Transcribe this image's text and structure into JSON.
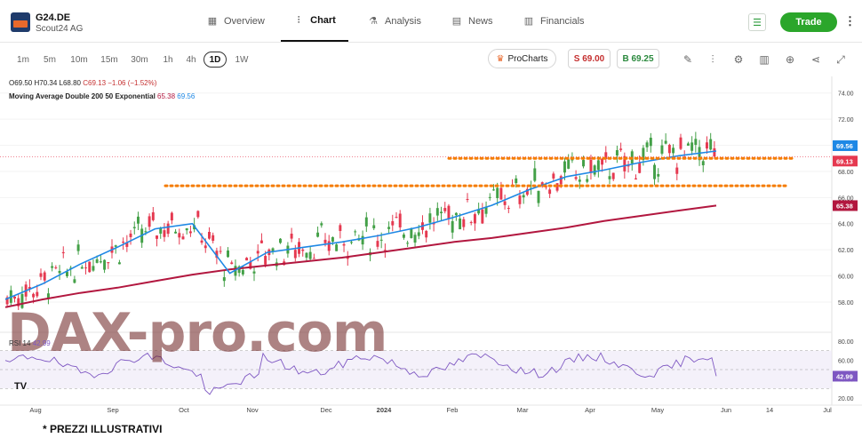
{
  "header": {
    "ticker": "G24.DE",
    "company": "Scout24 AG",
    "tabs": [
      {
        "label": "Overview",
        "icon": "grid-icon"
      },
      {
        "label": "Chart",
        "icon": "candlestick-icon"
      },
      {
        "label": "Analysis",
        "icon": "flask-icon"
      },
      {
        "label": "News",
        "icon": "news-icon"
      },
      {
        "label": "Financials",
        "icon": "bar-chart-icon"
      }
    ],
    "trade_label": "Trade"
  },
  "toolbar": {
    "timeframes": [
      "1m",
      "5m",
      "10m",
      "15m",
      "30m",
      "1h",
      "4h",
      "1D",
      "1W"
    ],
    "active_timeframe": "1D",
    "prochart_label": "ProCharts",
    "sell_label": "S 69.00",
    "buy_label": "B 69.25",
    "tools": [
      "pen-icon",
      "indicators-icon",
      "settings-icon",
      "compare-icon",
      "add-icon",
      "share-icon",
      "fullscreen-icon"
    ]
  },
  "legend": {
    "open": "O69.50",
    "high": "H70.34",
    "low": "L68.80",
    "close": "C69.13",
    "change": "−1.06 (−1.52%)",
    "ma_label": "Moving Average Double 200 50 Exponential",
    "ma200": "65.38",
    "ma50": "69.56",
    "rsi_label": "RSI 14",
    "rsi_value": "42.99"
  },
  "watermark": "DAX-pro.com",
  "tv_logo": "TV",
  "footnote": "* PREZZI ILLUSTRATIVI",
  "colors": {
    "up": "#43a047",
    "down": "#e53950",
    "ema50": "#1e88e5",
    "ema200": "#b2173f",
    "support": "#f57c00",
    "rsi": "#7e57c2"
  },
  "chart_data": {
    "type": "candlestick",
    "y_axis_ticks": [
      "74.00",
      "72.00",
      "70.00",
      "68.00",
      "66.00",
      "64.00",
      "62.00",
      "60.00",
      "58.00"
    ],
    "ylim": [
      56.5,
      75
    ],
    "x_axis_ticks": [
      "Aug",
      "Sep",
      "Oct",
      "Nov",
      "Dec",
      "2024",
      "Feb",
      "Mar",
      "Apr",
      "May",
      "Jun",
      "14",
      "Jul"
    ],
    "price_badges": [
      {
        "label": "69.56",
        "series": "ema50"
      },
      {
        "label": "69.13",
        "series": "last"
      },
      {
        "label": "65.38",
        "series": "ema200"
      }
    ],
    "support_levels": [
      66.9,
      69.0
    ],
    "rsi_axis_ticks": [
      "80.00",
      "60.00",
      "40.00",
      "20.00"
    ],
    "rsi_ylim": [
      18,
      82
    ],
    "rsi_badge": "42.99",
    "series": [
      {
        "name": "EMA 50",
        "values": [
          58.2,
          59.4,
          60.9,
          62.2,
          63.6,
          64.0,
          60.2,
          61.8,
          62.2,
          62.6,
          63.1,
          63.7,
          64.5,
          65.4,
          66.6,
          67.6,
          68.1,
          68.7,
          69.2,
          69.56
        ]
      },
      {
        "name": "EMA 200",
        "values": [
          57.6,
          58.2,
          58.7,
          59.1,
          59.6,
          60.1,
          60.5,
          60.8,
          61.1,
          61.4,
          61.8,
          62.2,
          62.6,
          62.9,
          63.3,
          63.7,
          64.2,
          64.6,
          65.0,
          65.38
        ]
      }
    ]
  }
}
